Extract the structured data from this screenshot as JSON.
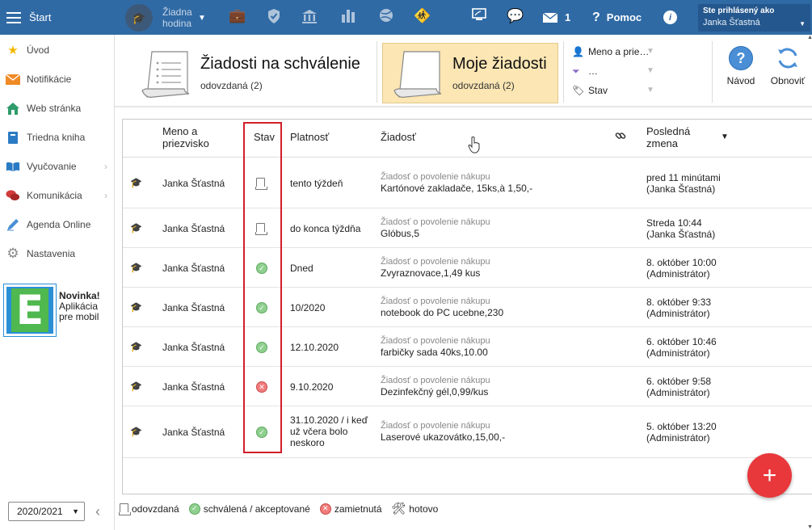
{
  "topbar": {
    "start_label": "Štart",
    "hodina_label": "Žiadna hodina",
    "messages_count": "1",
    "help_label": "Pomoc",
    "user_label": "Ste prihlásený ako",
    "user_name": "Janka Šťastná"
  },
  "sidebar": {
    "items": [
      {
        "label": "Úvod",
        "icon": "star-icon",
        "color": "#f2b705"
      },
      {
        "label": "Notifikácie",
        "icon": "envelope-icon",
        "color": "#f08a24"
      },
      {
        "label": "Web stránka",
        "icon": "home-icon",
        "color": "#2e9b6b"
      },
      {
        "label": "Triedna kniha",
        "icon": "book-icon",
        "color": "#2b7bc4"
      },
      {
        "label": "Vyučovanie",
        "icon": "open-book-icon",
        "color": "#2b7bc4"
      },
      {
        "label": "Komunikácia",
        "icon": "chat-icon",
        "color": "#d23b3b"
      },
      {
        "label": "Agenda Online",
        "icon": "pen-icon",
        "color": "#4a8fd6"
      },
      {
        "label": "Nastavenia",
        "icon": "gear-icon",
        "color": "#8a8a8a"
      }
    ],
    "promo_title": "Novinka!",
    "promo_line1": "Aplikácia",
    "promo_line2": "pre mobil",
    "promo_logo_letter": "E",
    "year": "2020/2021"
  },
  "toolbar": {
    "card1_title": "Žiadosti na schválenie",
    "card1_sub": "odovzdaná (2)",
    "card2_title": "Moje žiadosti",
    "card2_sub": "odovzdaná (2)",
    "filter1": "Meno a prie…",
    "filter2": "…",
    "filter3": "Stav",
    "help_button": "Návod",
    "refresh_button": "Obnoviť"
  },
  "table": {
    "headers": {
      "name": "Meno a priezvisko",
      "status": "Stav",
      "validity": "Platnosť",
      "request": "Žiadosť",
      "last_change": "Posledná zmena"
    },
    "rows": [
      {
        "name": "Janka Šťastná",
        "status": "doc",
        "validity": "tento týždeň",
        "type": "Žiadosť o povolenie nákupu",
        "detail": "Kartónové zakladače, 15ks,à 1,50,-",
        "change": "pred 11 minútami (Janka Šťastná)"
      },
      {
        "name": "Janka Šťastná",
        "status": "doc",
        "validity": "do konca týždňa",
        "type": "Žiadosť o povolenie nákupu",
        "detail": "Glóbus,5",
        "change": "Streda 10:44 (Janka Šťastná)"
      },
      {
        "name": "Janka Šťastná",
        "status": "ok",
        "validity": "Dned",
        "type": "Žiadosť o povolenie nákupu",
        "detail": "Zvyraznovace,1,49 kus",
        "change": "8. október 10:00 (Administrátor)"
      },
      {
        "name": "Janka Šťastná",
        "status": "ok",
        "validity": "10/2020",
        "type": "Žiadosť o povolenie nákupu",
        "detail": "notebook do PC ucebne,230",
        "change": "8. október 9:33 (Administrátor)"
      },
      {
        "name": "Janka Šťastná",
        "status": "ok",
        "validity": "12.10.2020",
        "type": "Žiadosť o povolenie nákupu",
        "detail": "farbičky sada 40ks,10.00",
        "change": "6. október 10:46 (Administrátor)"
      },
      {
        "name": "Janka Šťastná",
        "status": "no",
        "validity": "9.10.2020",
        "type": "Žiadosť o povolenie nákupu",
        "detail": "Dezinfekčný gél,0,99/kus",
        "change": "6. október 9:58 (Administrátor)"
      },
      {
        "name": "Janka Šťastná",
        "status": "ok",
        "validity": "31.10.2020 / i keď už včera bolo neskoro",
        "type": "Žiadosť o povolenie nákupu",
        "detail": "Laserové ukazovátko,15,00,-",
        "change": "5. október 13:20 (Administrátor)"
      }
    ]
  },
  "legend": {
    "submitted": "odovzdaná",
    "approved": "schválená / akceptované",
    "rejected": "zamietnutá",
    "done": "hotovo"
  },
  "colors": {
    "topbar": "#2f6aa5",
    "highlight": "#d21f2a",
    "fab": "#e8383b",
    "active_card": "#fbe6b4"
  }
}
